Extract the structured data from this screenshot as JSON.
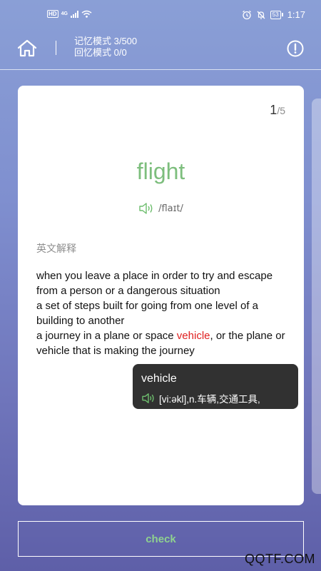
{
  "status_bar": {
    "hd": "HD",
    "network": "4G",
    "battery": "53",
    "time": "1:17"
  },
  "header": {
    "memory_mode": "记忆模式 3/500",
    "recall_mode": "回忆模式 0/0",
    "icons": {
      "home": "home-icon",
      "info": "info-icon"
    }
  },
  "card": {
    "counter_current": "1",
    "counter_total": "/5",
    "word": "flight",
    "phonetic": "/flaɪt/",
    "section_label": "英文解释",
    "definitions": {
      "d1": "when you leave a place in order to try and escape from a person or a dangerous situation",
      "d2": "a set of steps built for going from one level of a building to another",
      "d3_before": "a journey in a plane or space ",
      "d3_highlight": "vehicle",
      "d3_after": ", or the plane or vehicle that is making the journey"
    },
    "colors": {
      "word": "#7dbe7d",
      "highlight": "#e02020"
    }
  },
  "popup": {
    "word": "vehicle",
    "phonetic_meaning": "[vi:əkl],n.车辆,交通工具,"
  },
  "check_label": "check",
  "watermark": "QQTF.COM"
}
